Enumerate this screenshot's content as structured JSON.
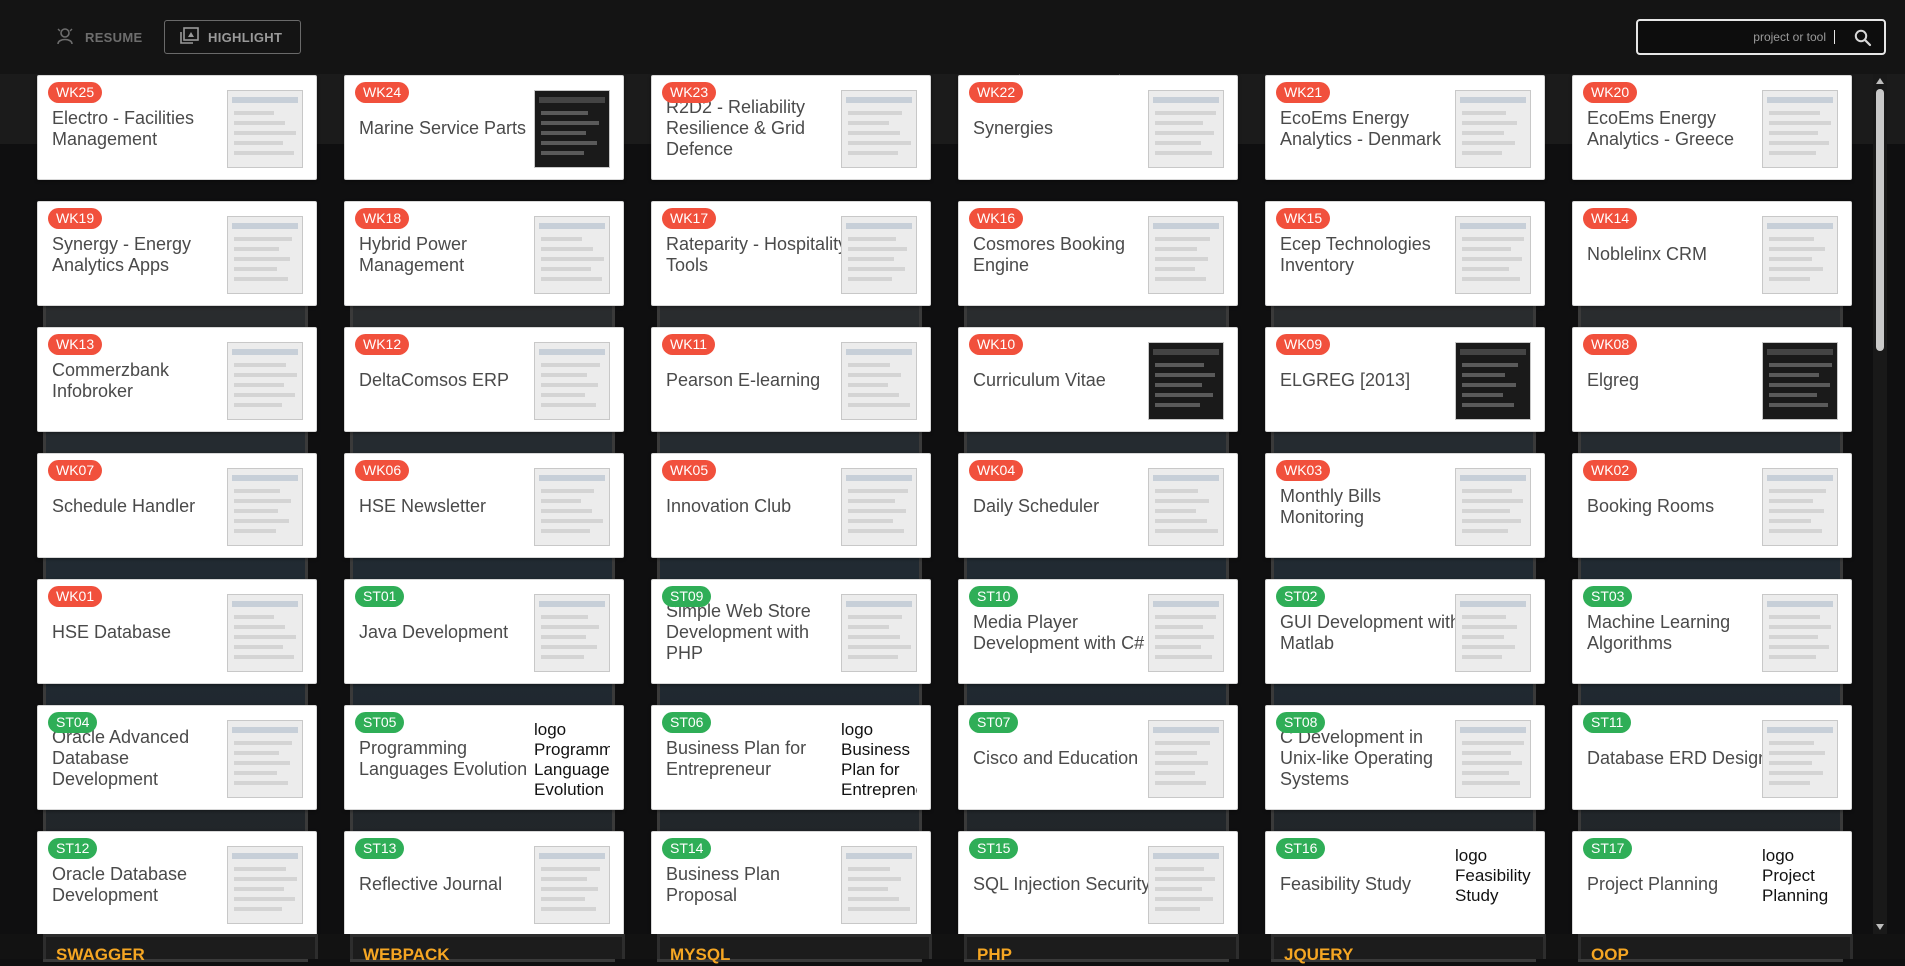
{
  "toolbar": {
    "resume_label": "RESUME",
    "highlight_label": "HIGHLIGHT"
  },
  "search": {
    "placeholder": "project or tool"
  },
  "projects": [
    {
      "code": "WK25",
      "kind": "wk",
      "title": "Electro - Facilities Management"
    },
    {
      "code": "WK24",
      "kind": "wk",
      "title": "Marine Service Parts"
    },
    {
      "code": "WK23",
      "kind": "wk",
      "title": "R2D2 - Reliability Resilience & Grid Defence"
    },
    {
      "code": "WK22",
      "kind": "wk",
      "title": "Synergies"
    },
    {
      "code": "WK21",
      "kind": "wk",
      "title": "EcoEms Energy Analytics - Denmark"
    },
    {
      "code": "WK20",
      "kind": "wk",
      "title": "EcoEms Energy Analytics - Greece"
    },
    {
      "code": "WK19",
      "kind": "wk",
      "title": "Synergy - Energy Analytics Apps"
    },
    {
      "code": "WK18",
      "kind": "wk",
      "title": "Hybrid Power Management"
    },
    {
      "code": "WK17",
      "kind": "wk",
      "title": "Rateparity - Hospitality Tools"
    },
    {
      "code": "WK16",
      "kind": "wk",
      "title": "Cosmores Booking Engine"
    },
    {
      "code": "WK15",
      "kind": "wk",
      "title": "Ecep Technologies Inventory"
    },
    {
      "code": "WK14",
      "kind": "wk",
      "title": "Noblelinx CRM"
    },
    {
      "code": "WK13",
      "kind": "wk",
      "title": "Commerzbank Infobroker"
    },
    {
      "code": "WK12",
      "kind": "wk",
      "title": "DeltaComsos ERP"
    },
    {
      "code": "WK11",
      "kind": "wk",
      "title": "Pearson E-learning"
    },
    {
      "code": "WK10",
      "kind": "wk",
      "title": "Curriculum Vitae"
    },
    {
      "code": "WK09",
      "kind": "wk",
      "title": "ELGREG [2013]"
    },
    {
      "code": "WK08",
      "kind": "wk",
      "title": "Elgreg"
    },
    {
      "code": "WK07",
      "kind": "wk",
      "title": "Schedule Handler"
    },
    {
      "code": "WK06",
      "kind": "wk",
      "title": "HSE Newsletter"
    },
    {
      "code": "WK05",
      "kind": "wk",
      "title": "Innovation Club"
    },
    {
      "code": "WK04",
      "kind": "wk",
      "title": "Daily Scheduler"
    },
    {
      "code": "WK03",
      "kind": "wk",
      "title": "Monthly Bills Monitoring"
    },
    {
      "code": "WK02",
      "kind": "wk",
      "title": "Booking Rooms"
    },
    {
      "code": "WK01",
      "kind": "wk",
      "title": "HSE Database"
    },
    {
      "code": "ST01",
      "kind": "st",
      "title": "Java Development"
    },
    {
      "code": "ST09",
      "kind": "st",
      "title": "Simple Web Store Development with PHP"
    },
    {
      "code": "ST10",
      "kind": "st",
      "title": "Media Player Development with C#"
    },
    {
      "code": "ST02",
      "kind": "st",
      "title": "GUI Development with Matlab"
    },
    {
      "code": "ST03",
      "kind": "st",
      "title": "Machine Learning Algorithms"
    },
    {
      "code": "ST04",
      "kind": "st",
      "title": "Oracle Advanced Database Development"
    },
    {
      "code": "ST05",
      "kind": "st",
      "title": "Programming Languages Evolution",
      "alt": "logo Programming Languages Evolution"
    },
    {
      "code": "ST06",
      "kind": "st",
      "title": "Business Plan for Entrepreneur",
      "alt": "logo Business Plan for Entrepreneur"
    },
    {
      "code": "ST07",
      "kind": "st",
      "title": "Cisco and Education"
    },
    {
      "code": "ST08",
      "kind": "st",
      "title": "C Development in Unix-like Operating Systems"
    },
    {
      "code": "ST11",
      "kind": "st",
      "title": "Database ERD Design"
    },
    {
      "code": "ST12",
      "kind": "st",
      "title": "Oracle Database Development"
    },
    {
      "code": "ST13",
      "kind": "st",
      "title": "Reflective Journal"
    },
    {
      "code": "ST14",
      "kind": "st",
      "title": "Business Plan Proposal"
    },
    {
      "code": "ST15",
      "kind": "st",
      "title": "SQL Injection Security"
    },
    {
      "code": "ST16",
      "kind": "st",
      "title": "Feasibility Study",
      "alt": "logo Feasibility Study"
    },
    {
      "code": "ST17",
      "kind": "st",
      "title": "Project Planning",
      "alt": "logo Project Planning"
    }
  ],
  "tools": [
    "SWAGGER",
    "WEBPACK",
    "MYSQL",
    "PHP",
    "JQUERY",
    "OOP"
  ],
  "colors": {
    "wk_badge": "#f1503c",
    "st_badge": "#2fae57",
    "tool_label": "#f5a623"
  },
  "icons": {
    "resume": "resume-icon",
    "highlight": "highlight-icon",
    "search": "search-icon"
  }
}
